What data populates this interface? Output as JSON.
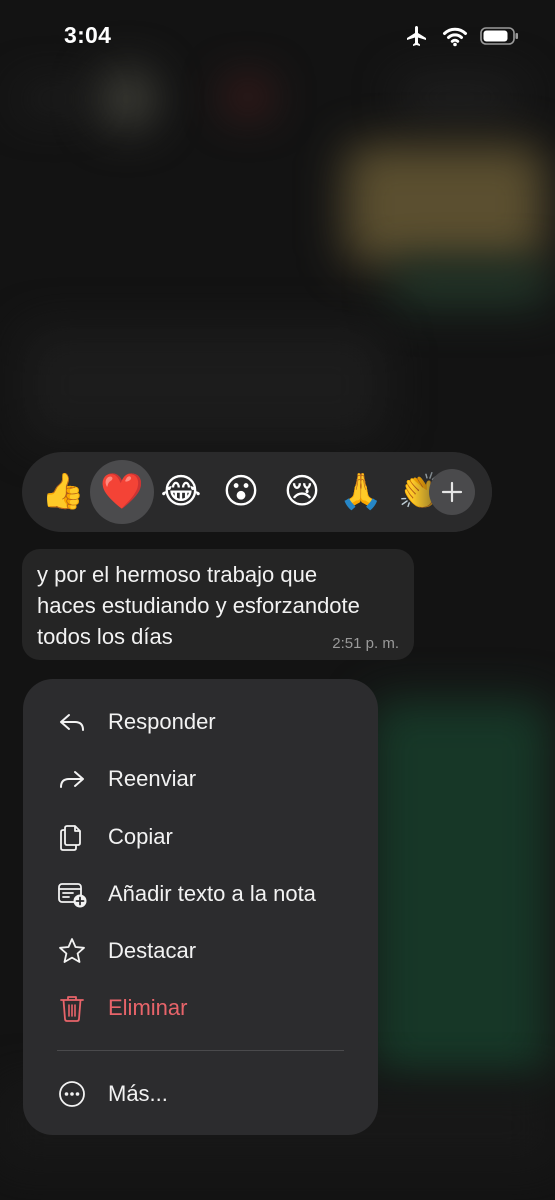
{
  "status_bar": {
    "time": "3:04",
    "icons": [
      "airplane-icon",
      "wifi-icon",
      "battery-icon"
    ]
  },
  "reactions": {
    "items": [
      {
        "emoji": "👍",
        "name": "thumbs-up",
        "selected": false
      },
      {
        "emoji": "❤️",
        "name": "red-heart",
        "selected": true
      },
      {
        "emoji": "😂",
        "name": "tears-of-joy",
        "selected": false
      },
      {
        "emoji": "😮",
        "name": "surprised",
        "selected": false
      },
      {
        "emoji": "😢",
        "name": "crying",
        "selected": false
      },
      {
        "emoji": "🙏",
        "name": "folded-hands",
        "selected": false
      },
      {
        "emoji": "👏",
        "name": "clapping-hands",
        "selected": false
      }
    ],
    "more_icon": "plus-icon"
  },
  "message": {
    "lines": [
      "y por el hermoso trabajo que",
      "haces estudiando y esforzandote",
      "todos los días"
    ],
    "time": "2:51 p. m."
  },
  "menu": {
    "reply": {
      "label": "Responder",
      "icon": "reply-icon"
    },
    "forward": {
      "label": "Reenviar",
      "icon": "forward-icon"
    },
    "copy": {
      "label": "Copiar",
      "icon": "copy-icon"
    },
    "add_note": {
      "label": "Añadir texto a la nota",
      "icon": "add-note-icon"
    },
    "star": {
      "label": "Destacar",
      "icon": "star-icon"
    },
    "delete": {
      "label": "Eliminar",
      "icon": "trash-icon"
    },
    "more": {
      "label": "Más...",
      "icon": "more-icon"
    }
  },
  "colors": {
    "danger": "#e8646a",
    "menu_background": "#2c2c2e",
    "bubble_background": "#252525"
  }
}
